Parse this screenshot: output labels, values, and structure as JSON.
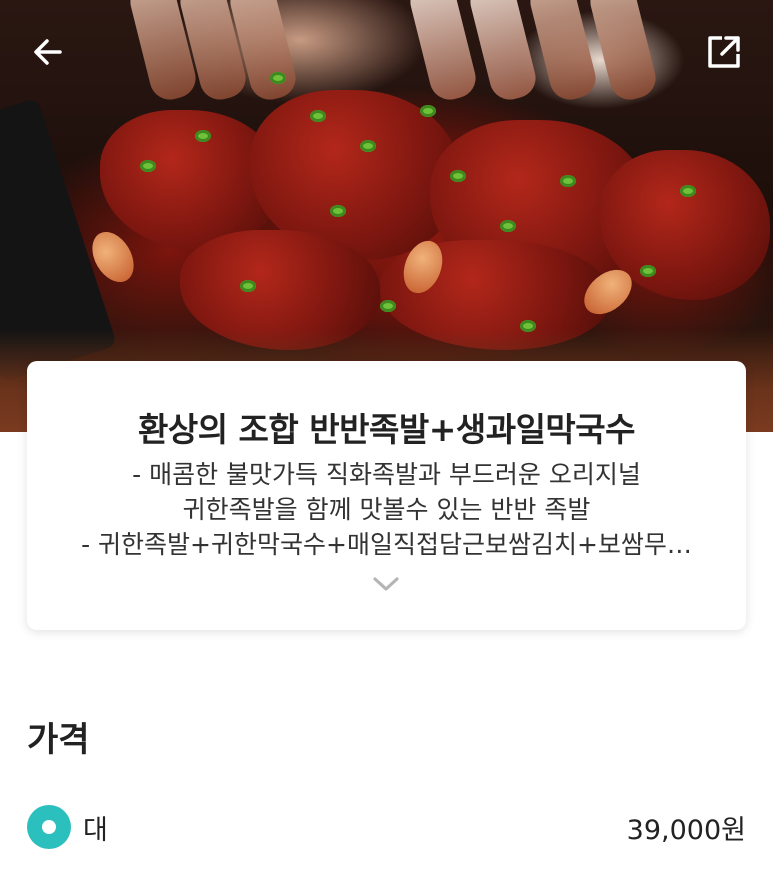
{
  "menu": {
    "title": "환상의 조합 반반족발+생과일막국수",
    "description_lines": [
      "- 매콤한 불맛가득 직화족발과 부드러운 오리지널",
      "귀한족발을 함께 맛볼수 있는 반반 족발",
      "- 귀한족발+귀한막국수+매일직접담근보쌈김치+보쌈무…"
    ]
  },
  "header": {
    "back_icon": "arrow-left-icon",
    "share_icon": "share-external-icon"
  },
  "price_section": {
    "title": "가격",
    "options": [
      {
        "label": "대",
        "price": "39,000원",
        "selected": true
      }
    ]
  },
  "colors": {
    "accent": "#2bbfbe",
    "text": "#222222"
  }
}
